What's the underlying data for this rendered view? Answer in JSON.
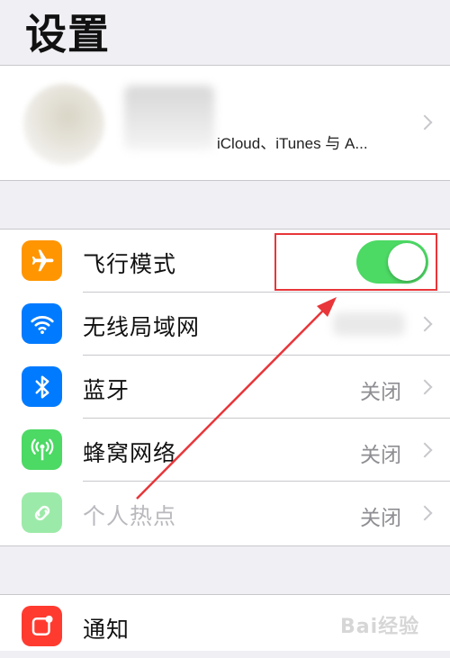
{
  "header": {
    "title": "设置"
  },
  "profile": {
    "subtitle": "iCloud、iTunes 与 A..."
  },
  "settings": [
    {
      "label": "飞行模式",
      "value": "",
      "icon": "airplane-icon",
      "color": "#ff9500",
      "toggle_on": true
    },
    {
      "label": "无线局域网",
      "value": "",
      "icon": "wifi-icon",
      "color": "#007aff"
    },
    {
      "label": "蓝牙",
      "value": "关闭",
      "icon": "bluetooth-icon",
      "color": "#007aff"
    },
    {
      "label": "蜂窝网络",
      "value": "关闭",
      "icon": "cellular-icon",
      "color": "#4cd964"
    },
    {
      "label": "个人热点",
      "value": "关闭",
      "icon": "hotspot-icon",
      "color": "#4cd964",
      "disabled": true
    }
  ],
  "notifications": {
    "label": "通知",
    "icon": "notifications-icon",
    "color": "#ff3b30"
  },
  "watermark": {
    "text": "Bai经验"
  },
  "colors": {
    "toggle_on": "#4cd964",
    "highlight": "#e8363a",
    "background": "#efeff4"
  }
}
